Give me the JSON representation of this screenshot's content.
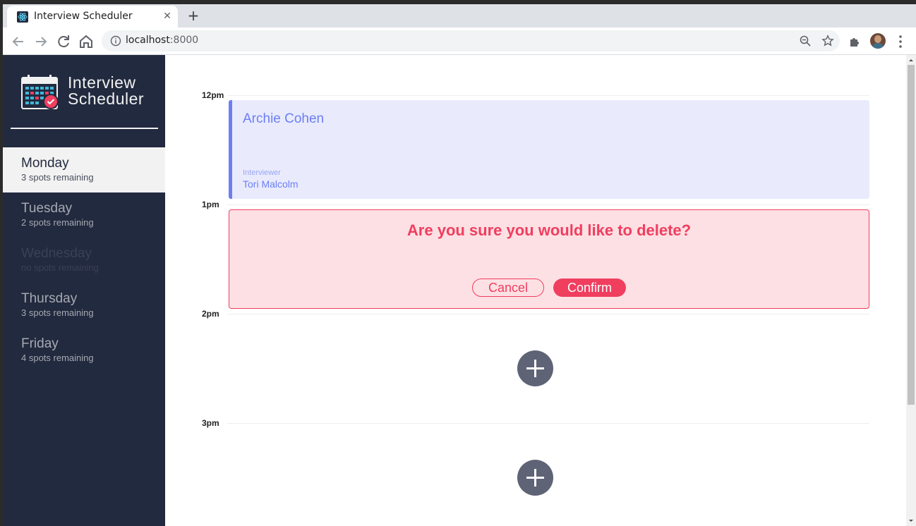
{
  "browser": {
    "tab_title": "Interview Scheduler",
    "tab_close": "✕",
    "new_tab": "+",
    "url_host": "localhost",
    "url_port": ":8000"
  },
  "app": {
    "logo_line1": "Interview",
    "logo_line2": "Scheduler"
  },
  "sidebar": {
    "days": [
      {
        "name": "Monday",
        "spots": "3 spots remaining",
        "selected": true
      },
      {
        "name": "Tuesday",
        "spots": "2 spots remaining",
        "selected": false
      },
      {
        "name": "Wednesday",
        "spots": "no spots remaining",
        "selected": false
      },
      {
        "name": "Thursday",
        "spots": "3 spots remaining",
        "selected": false
      },
      {
        "name": "Friday",
        "spots": "4 spots remaining",
        "selected": false
      }
    ]
  },
  "schedule": {
    "times": [
      "12pm",
      "1pm",
      "2pm",
      "3pm"
    ],
    "appointment": {
      "student": "Archie Cohen",
      "interviewer_label": "Interviewer",
      "interviewer": "Tori Malcolm"
    },
    "confirm": {
      "message": "Are you sure you would like to delete?",
      "cancel": "Cancel",
      "confirm": "Confirm"
    }
  },
  "colors": {
    "sidebar_bg": "#222a3f",
    "accent": "#6c7ef2",
    "danger": "#f03e5f",
    "add_button": "#5e6375"
  }
}
